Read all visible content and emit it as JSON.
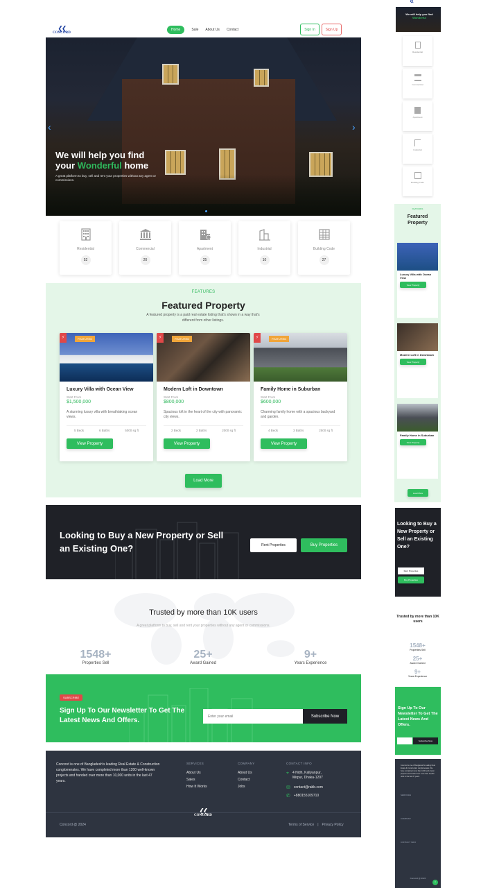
{
  "brand": {
    "name": "CONCORD"
  },
  "nav": {
    "items": [
      {
        "label": "Home",
        "active": true
      },
      {
        "label": "Sale",
        "active": false
      },
      {
        "label": "About Us",
        "active": false
      },
      {
        "label": "Contact",
        "active": false
      }
    ],
    "signin": "Sign In",
    "signup": "Sign Up"
  },
  "hero": {
    "line1": "We will help you find",
    "line2_prefix": "your ",
    "line2_highlight": "Wonderful",
    "line2_suffix": " home",
    "subtitle": "A great platform to buy, sell and rent your properties without any agent or commissions."
  },
  "categories": [
    {
      "label": "Residential",
      "count": "52",
      "icon": "building-icon"
    },
    {
      "label": "Commercial",
      "count": "20",
      "icon": "bank-icon"
    },
    {
      "label": "Apartment",
      "count": "25",
      "icon": "apartment-icon"
    },
    {
      "label": "Industrial",
      "count": "10",
      "icon": "factory-icon"
    },
    {
      "label": "Building Code",
      "count": "27",
      "icon": "building-code-icon"
    }
  ],
  "featured": {
    "eyebrow": "FEATURES",
    "title": "Featured Property",
    "subtitle": "A featured property is a paid real estate listing that's shown in a way that's different from other listings.",
    "badge": "FEATURED",
    "from_label": "Start From",
    "button": "View Property",
    "load_more": "Load More",
    "properties": [
      {
        "name": "Luxury Villa with Ocean View",
        "price": "$1,500,000",
        "desc": "A stunning luxury villa with breathtaking ocean views.",
        "beds": "5 Beds",
        "baths": "6 Baths",
        "area": "5000 sq ft"
      },
      {
        "name": "Modern Loft in Downtown",
        "price": "$800,000",
        "desc": "Spacious loft in the heart of the city with panoramic city views.",
        "beds": "2 Beds",
        "baths": "2 Baths",
        "area": "2000 sq ft"
      },
      {
        "name": "Family Home in Suburban",
        "price": "$600,000",
        "desc": "Charming family home with a spacious backyard and garden.",
        "beds": "4 Beds",
        "baths": "3 Baths",
        "area": "2500 sq ft"
      }
    ]
  },
  "cta": {
    "title": "Looking to Buy a New Property or Sell an Existing One?",
    "rent": "Rent Properties",
    "buy": "Buy Properties"
  },
  "trusted": {
    "title": "Trusted by more than 10K users",
    "subtitle": "A great platform to buy, sell and rent your properties without any agent or commissions.",
    "stats": [
      {
        "value": "1548+",
        "label": "Properties Sell"
      },
      {
        "value": "25+",
        "label": "Award Gained"
      },
      {
        "value": "9+",
        "label": "Years Experience"
      }
    ]
  },
  "newsletter": {
    "tag": "SUBSCRIBE",
    "title": "Sign Up To Our Newsletter To Get The Latest News And Offers.",
    "placeholder": "Enter your email",
    "button": "Subscribe Now"
  },
  "footer": {
    "about": "Concord is one of Bangladesh's leading Real Estate & Construction conglomerates. We have completed more than 1200 well-known projects and handed over more than 10,000 units in the last 47 years.",
    "services_title": "SERVICES",
    "services": [
      "About Us",
      "Sales",
      "How It Works"
    ],
    "company_title": "COMPANY",
    "company": [
      "About Us",
      "Contact",
      "Jobs"
    ],
    "contact_title": "CONTACT INFO",
    "address": "4 Nidh, Kallyanpur, Mirpur, Dhaka-1207",
    "email": "contact@rabb.com",
    "phone": "+880155109710",
    "copyright": "Concord @ 2024",
    "terms": "Terms of Service",
    "privacy": "Privacy Policy"
  },
  "colors": {
    "accent": "#2fbd5e",
    "dark": "#1f2127",
    "footer": "#2e3440",
    "featured_bg": "#e4f6e8",
    "badge": "#f0a53a"
  }
}
